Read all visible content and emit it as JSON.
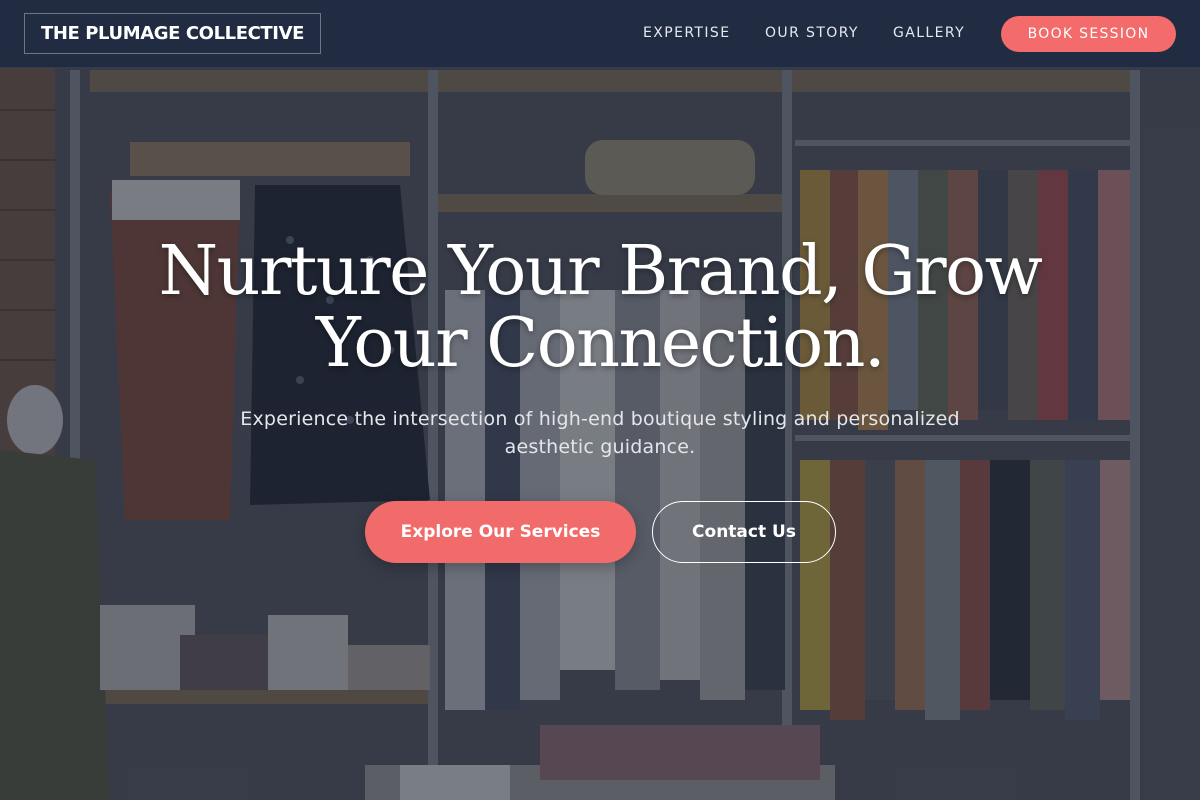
{
  "header": {
    "logo_text": "THE PLUMAGE COLLECTIVE",
    "nav": {
      "expertise": "EXPERTISE",
      "our_story": "OUR STORY",
      "gallery": "GALLERY"
    },
    "book_button": "BOOK SESSION"
  },
  "hero": {
    "headline_line1": "Nurture Your Brand, Grow",
    "headline_line2": "Your Connection.",
    "subtitle_line1": "Experience the intersection of high-end boutique styling and personalized",
    "subtitle_line2": "aesthetic guidance.",
    "primary_cta": "Explore Our Services",
    "secondary_cta": "Contact Us"
  },
  "colors": {
    "accent": "#f36b6b",
    "header_background": "#202c42",
    "text": "#ffffff"
  }
}
